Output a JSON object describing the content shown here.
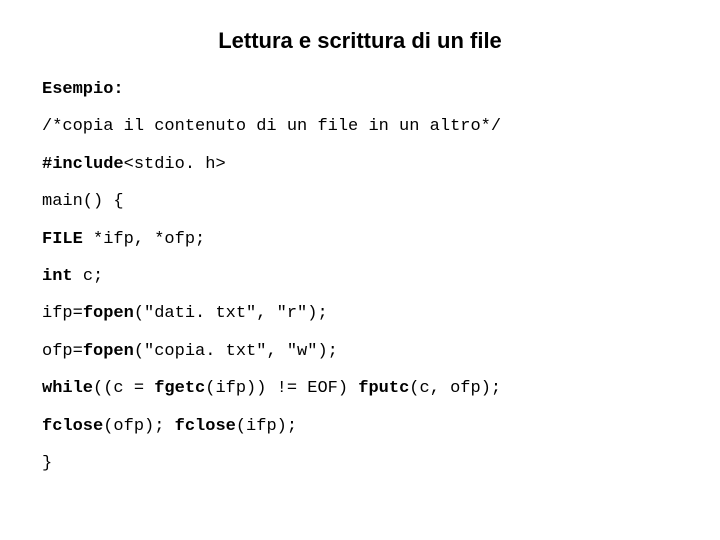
{
  "title": "Lettura e scrittura di un file",
  "lines": {
    "0": {
      "0": "Esempio:"
    },
    "1": {
      "0": "/*copia il contenuto di un file in un altro*/"
    },
    "2": {
      "0": "#include",
      "1": "<stdio. h>"
    },
    "3": {
      "0": "main() {"
    },
    "4": {
      "0": "FILE ",
      "1": "*ifp, *ofp;"
    },
    "5": {
      "0": "int ",
      "1": "c;"
    },
    "6": {
      "0": "ifp=",
      "1": "fopen",
      "2": "(\"dati. txt\", \"r\");"
    },
    "7": {
      "0": "ofp=",
      "1": "fopen",
      "2": "(\"copia. txt\", \"w\");"
    },
    "8": {
      "0": "while",
      "1": "((c = ",
      "2": "fgetc",
      "3": "(ifp)) != EOF) ",
      "4": "fputc",
      "5": "(c, ofp);"
    },
    "9": {
      "0": "fclose",
      "1": "(ofp); ",
      "2": "fclose",
      "3": "(ifp);"
    },
    "10": {
      "0": "}"
    }
  }
}
